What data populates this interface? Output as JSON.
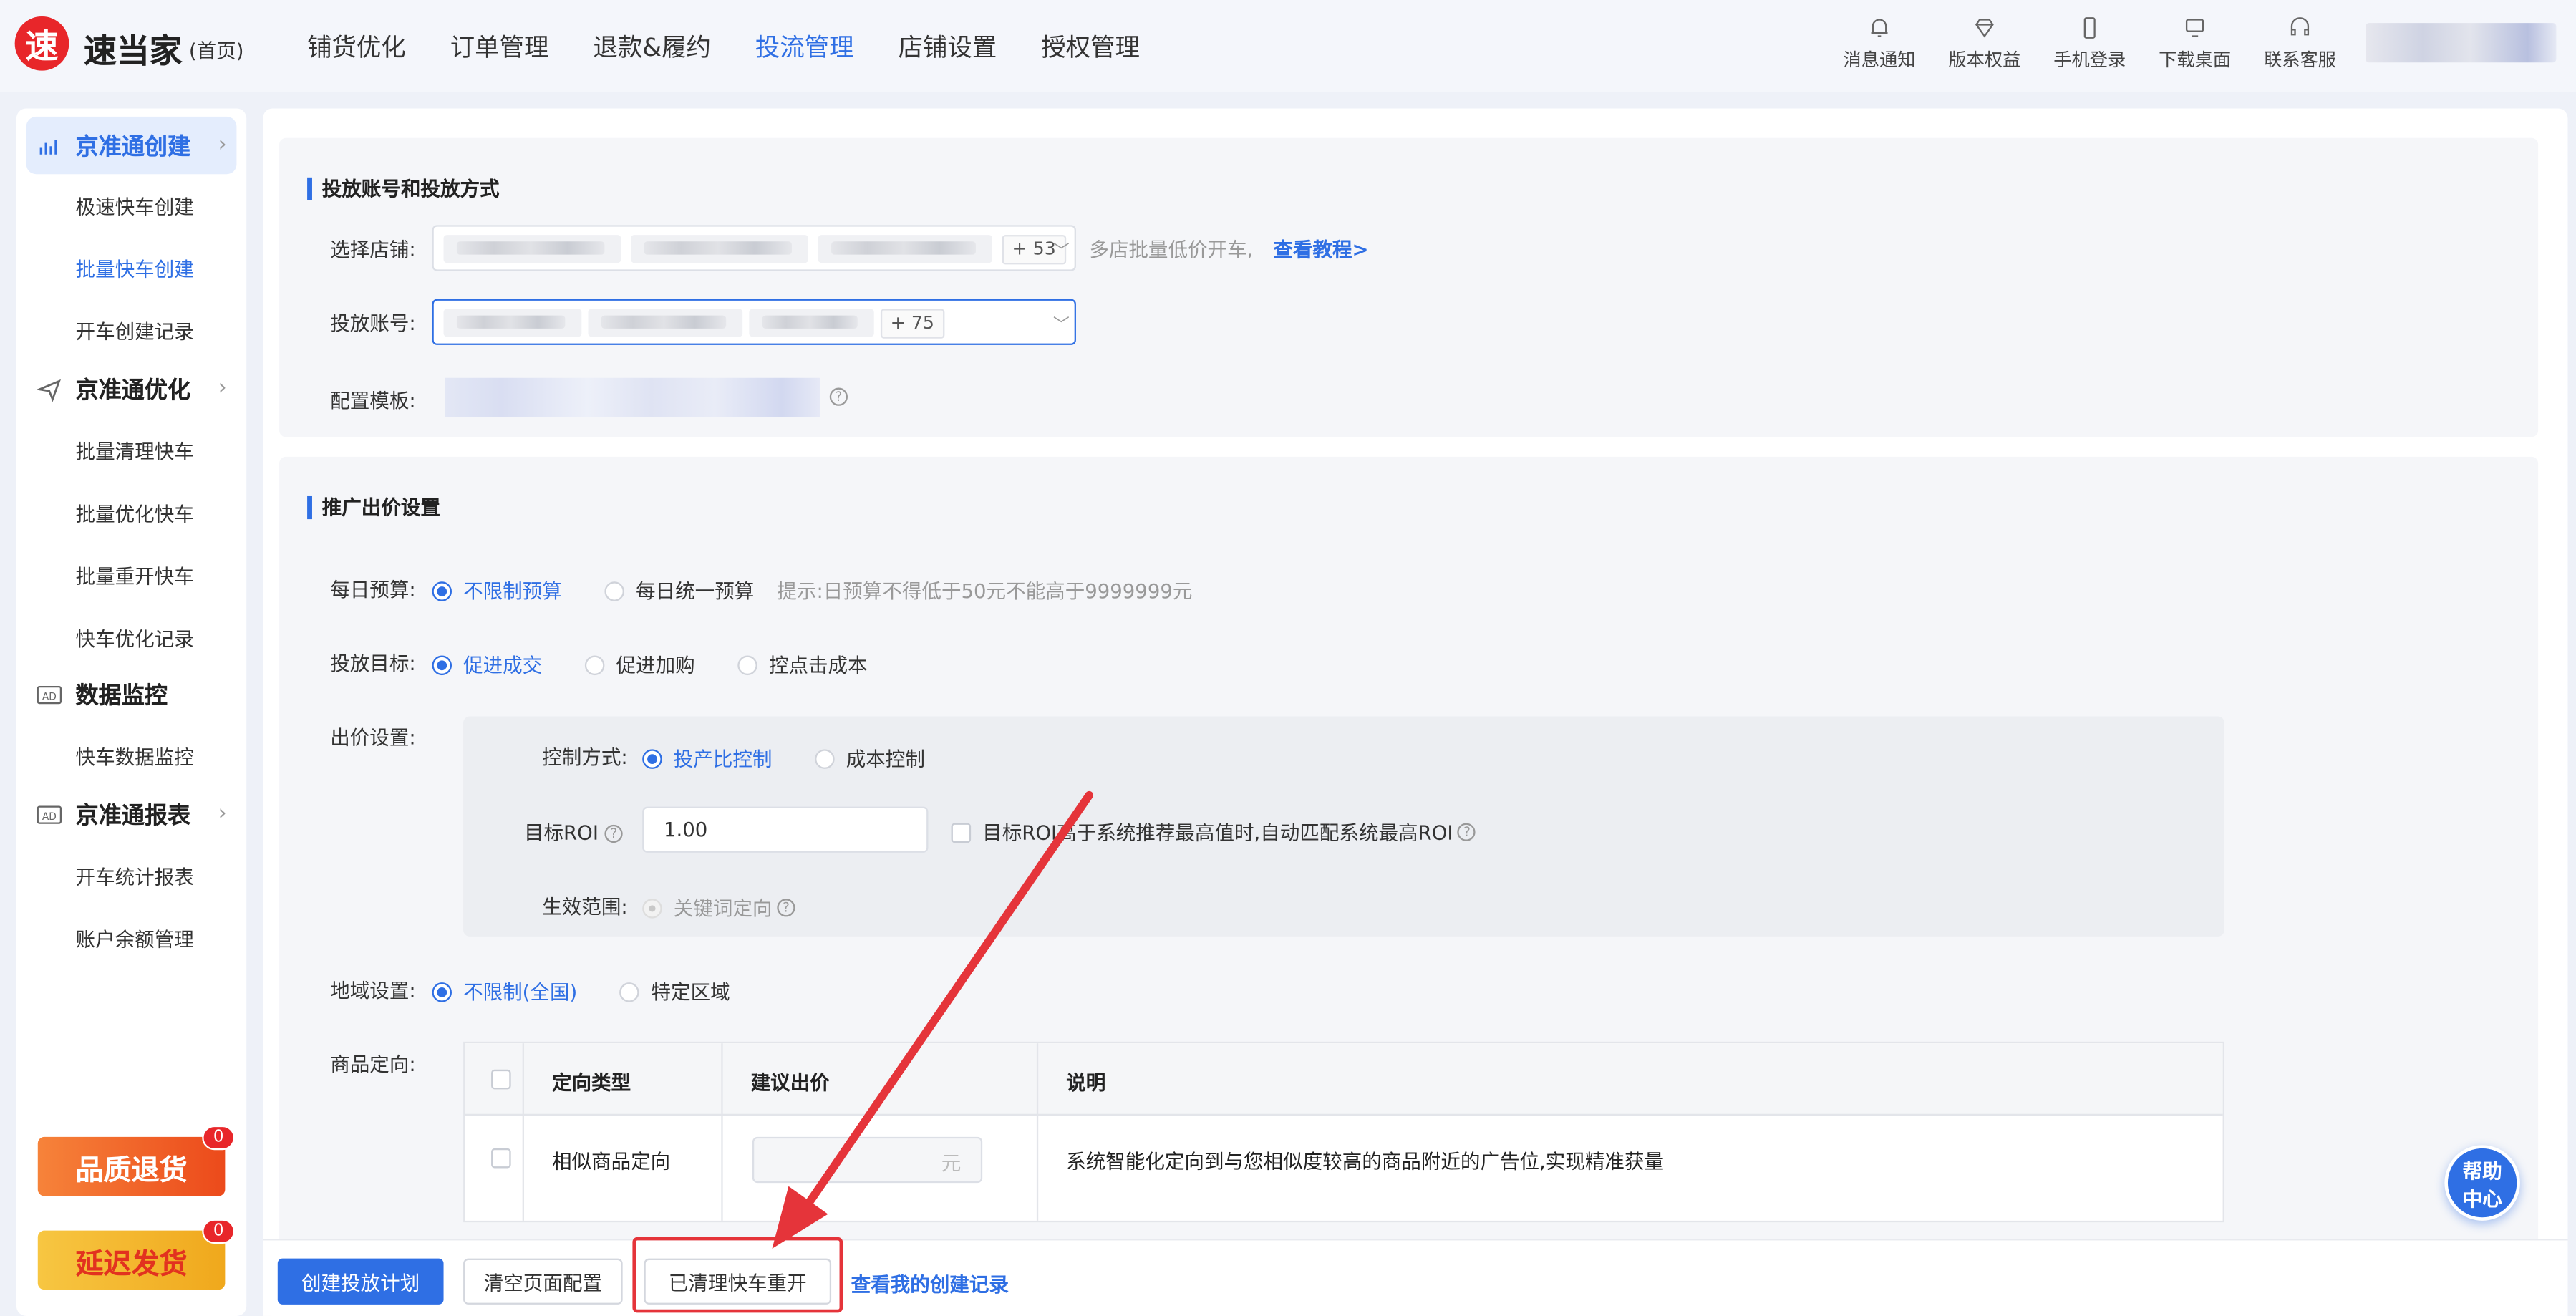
{
  "app": {
    "logo_char": "速",
    "name": "速当家",
    "home_label": "(首页)"
  },
  "topnav": [
    {
      "label": "铺货优化"
    },
    {
      "label": "订单管理"
    },
    {
      "label": "退款&履约"
    },
    {
      "label": "投流管理",
      "active": true
    },
    {
      "label": "店铺设置"
    },
    {
      "label": "授权管理"
    }
  ],
  "tools": [
    {
      "label": "消息通知",
      "icon": "bell-icon"
    },
    {
      "label": "版本权益",
      "icon": "diamond-icon"
    },
    {
      "label": "手机登录",
      "icon": "phone-icon"
    },
    {
      "label": "下载桌面",
      "icon": "monitor-icon"
    },
    {
      "label": "联系客服",
      "icon": "headset-icon"
    }
  ],
  "sidebar": {
    "groups": [
      {
        "label": "京准通创建",
        "icon": "bar-chart-icon",
        "active": true,
        "items": [
          "极速快车创建",
          "批量快车创建",
          "开车创建记录"
        ],
        "active_item": "批量快车创建"
      },
      {
        "label": "京准通优化",
        "icon": "send-icon",
        "items": [
          "批量清理快车",
          "批量优化快车",
          "批量重开快车",
          "快车优化记录"
        ]
      },
      {
        "label": "数据监控",
        "icon": "ad-icon",
        "items": [
          "快车数据监控"
        ]
      },
      {
        "label": "京准通报表",
        "icon": "ad-icon",
        "items": [
          "开车统计报表",
          "账户余额管理"
        ]
      }
    ],
    "promos": [
      {
        "label": "品质退货",
        "badge": "0",
        "color": "#f0501e"
      },
      {
        "label": "延迟发货",
        "badge": "0",
        "color": "#f5b51f"
      }
    ]
  },
  "section_account": {
    "title": "投放账号和投放方式",
    "shop_label": "选择店铺:",
    "shop_more": "+ 53",
    "shop_hint": "多店批量低价开车,",
    "tutorial_link": "查看教程>",
    "account_label": "投放账号:",
    "account_more": "+ 75",
    "template_label": "配置模板:"
  },
  "section_bid": {
    "title": "推广出价设置",
    "budget_label": "每日预算:",
    "budget_options": [
      "不限制预算",
      "每日统一预算"
    ],
    "budget_selected": "不限制预算",
    "budget_hint": "提示:日预算不得低于50元不能高于9999999元",
    "goal_label": "投放目标:",
    "goal_options": [
      "促进成交",
      "促进加购",
      "控点击成本"
    ],
    "goal_selected": "促进成交",
    "bid_label": "出价设置:",
    "control_label": "控制方式:",
    "control_options": [
      "投产比控制",
      "成本控制"
    ],
    "control_selected": "投产比控制",
    "roi_label": "目标ROI",
    "roi_value": "1.00",
    "roi_auto_text": "目标ROI高于系统推荐最高值时,自动匹配系统最高ROI",
    "scope_label": "生效范围:",
    "scope_value": "关键词定向",
    "region_label": "地域设置:",
    "region_options": [
      "不限制(全国)",
      "特定区域"
    ],
    "region_selected": "不限制(全国)",
    "target_label": "商品定向:",
    "table": {
      "headers": [
        "定向类型",
        "建议出价",
        "说明"
      ],
      "rows": [
        {
          "type": "相似商品定向",
          "price_unit": "元",
          "desc": "系统智能化定向到与您相似度较高的商品附近的广告位,实现精准获量"
        }
      ]
    }
  },
  "footer": {
    "create_button": "创建投放计划",
    "clear_button": "清空页面配置",
    "cleaned_restart_button": "已清理快车重开",
    "records_link": "查看我的创建记录"
  },
  "help_button": [
    "帮助",
    "中心"
  ],
  "colors": {
    "accent": "#2f6fe4",
    "annotation_red": "#e5343a"
  }
}
